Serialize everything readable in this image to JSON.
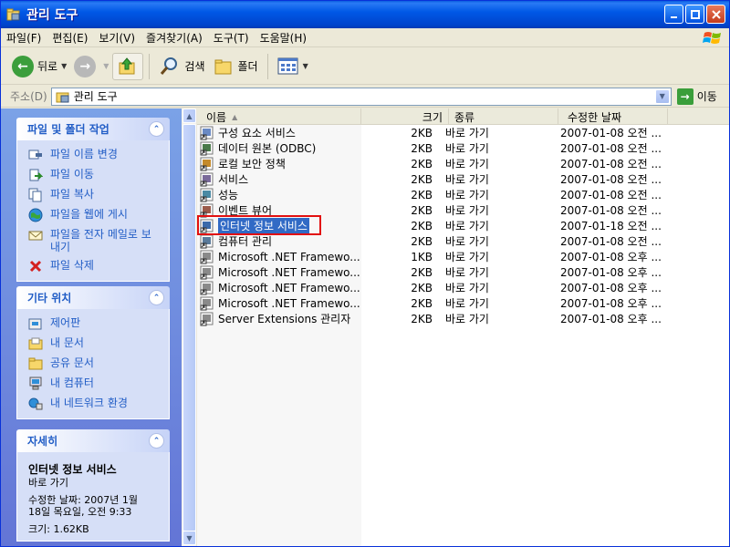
{
  "window": {
    "title": "관리 도구"
  },
  "menu": [
    "파일(F)",
    "편집(E)",
    "보기(V)",
    "즐겨찾기(A)",
    "도구(T)",
    "도움말(H)"
  ],
  "toolbar": {
    "back": "뒤로",
    "search": "검색",
    "folders": "폴더"
  },
  "address": {
    "label": "주소(D)",
    "value": "관리 도구",
    "go": "이동"
  },
  "tasks_panel": {
    "title": "파일 및 폴더 작업",
    "items": [
      "파일 이름 변경",
      "파일 이동",
      "파일 복사",
      "파일을 웹에 게시",
      "파일을 전자 메일로 보내기",
      "파일 삭제"
    ]
  },
  "other_panel": {
    "title": "기타 위치",
    "items": [
      "제어판",
      "내 문서",
      "공유 문서",
      "내 컴퓨터",
      "내 네트워크 환경"
    ]
  },
  "details_panel": {
    "title": "자세히",
    "name": "인터넷 정보 서비스",
    "type": "바로 가기",
    "modified_1": "수정한 날짜: 2007년 1월",
    "modified_2": "18일 목요일, 오전 9:33",
    "size": "크기: 1.62KB"
  },
  "columns": {
    "name": "이름",
    "size": "크기",
    "type": "종류",
    "date": "수정한 날짜"
  },
  "files": [
    {
      "name": "구성 요소 서비스",
      "size": "2KB",
      "type": "바로 가기",
      "date": "2007-01-08 오전 ..."
    },
    {
      "name": "데이터 원본 (ODBC)",
      "size": "2KB",
      "type": "바로 가기",
      "date": "2007-01-08 오전 ..."
    },
    {
      "name": "로컬 보안 정책",
      "size": "2KB",
      "type": "바로 가기",
      "date": "2007-01-08 오전 ..."
    },
    {
      "name": "서비스",
      "size": "2KB",
      "type": "바로 가기",
      "date": "2007-01-08 오전 ..."
    },
    {
      "name": "성능",
      "size": "2KB",
      "type": "바로 가기",
      "date": "2007-01-08 오전 ..."
    },
    {
      "name": "이벤트 뷰어",
      "size": "2KB",
      "type": "바로 가기",
      "date": "2007-01-08 오전 ..."
    },
    {
      "name": "인터넷 정보 서비스",
      "size": "2KB",
      "type": "바로 가기",
      "date": "2007-01-18 오전 ..."
    },
    {
      "name": "컴퓨터 관리",
      "size": "2KB",
      "type": "바로 가기",
      "date": "2007-01-08 오전 ..."
    },
    {
      "name": "Microsoft .NET Framewo...",
      "size": "1KB",
      "type": "바로 가기",
      "date": "2007-01-08 오후 ..."
    },
    {
      "name": "Microsoft .NET Framewo...",
      "size": "2KB",
      "type": "바로 가기",
      "date": "2007-01-08 오후 ..."
    },
    {
      "name": "Microsoft .NET Framewo...",
      "size": "2KB",
      "type": "바로 가기",
      "date": "2007-01-08 오후 ..."
    },
    {
      "name": "Microsoft .NET Framewo...",
      "size": "2KB",
      "type": "바로 가기",
      "date": "2007-01-08 오후 ..."
    },
    {
      "name": "Server Extensions 관리자",
      "size": "2KB",
      "type": "바로 가기",
      "date": "2007-01-08 오후 ..."
    }
  ],
  "selected_index": 6
}
